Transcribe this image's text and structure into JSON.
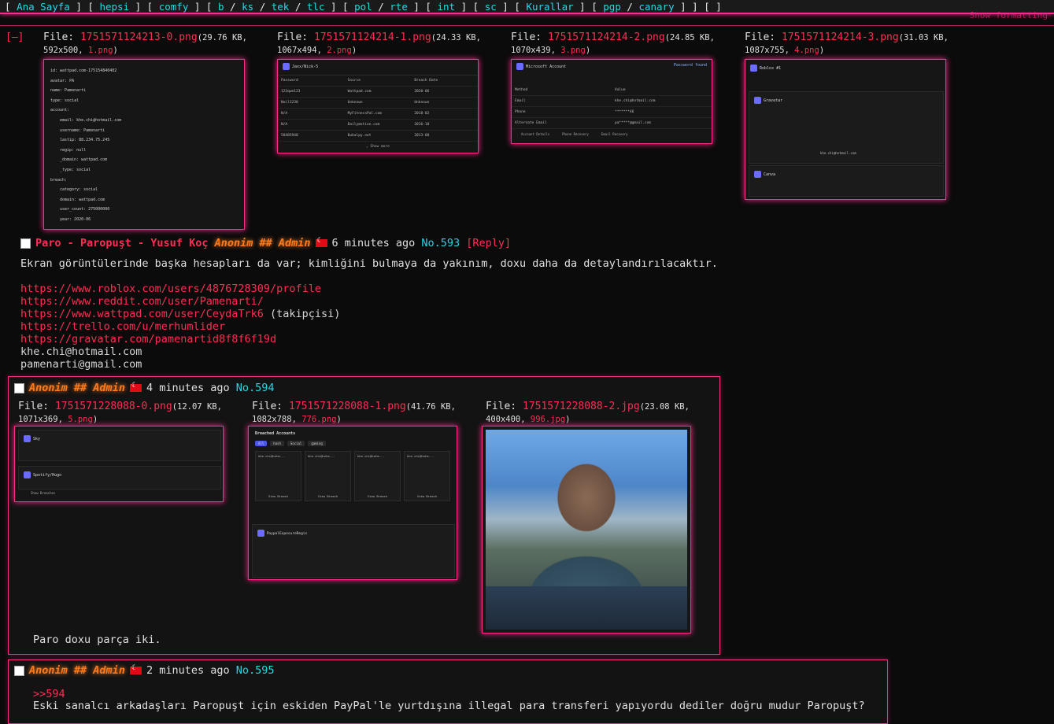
{
  "nav": {
    "items": [
      {
        "label": "Ana Sayfa"
      },
      {
        "label": "hepsi"
      },
      {
        "label": "comfy"
      },
      {
        "label": "b"
      },
      {
        "label": "ks"
      },
      {
        "label": "tek"
      },
      {
        "label": "tlc"
      },
      {
        "label": "pol"
      },
      {
        "label": "rte"
      },
      {
        "label": "int"
      },
      {
        "label": "sc"
      },
      {
        "label": "Kurallar"
      },
      {
        "label": "pgp"
      },
      {
        "label": "canary"
      }
    ],
    "show_formatting": "Show formatting",
    "collapse": "[–]"
  },
  "op": {
    "files": [
      {
        "label": "File:",
        "name": "1751571124213-0.png",
        "size": "(29.76 KB,",
        "dims": "592x500,",
        "orig": "1.png",
        ")": ")"
      },
      {
        "label": "File:",
        "name": "1751571124214-1.png",
        "size": "(24.33 KB,",
        "dims": "1067x494,",
        "orig": "2.png"
      },
      {
        "label": "File:",
        "name": "1751571124214-2.png",
        "size": "(24.85 KB,",
        "dims": "1070x439,",
        "orig": "3.png"
      },
      {
        "label": "File:",
        "name": "1751571124214-3.png",
        "size": "(31.03 KB,",
        "dims": "1087x755,",
        "orig": "4.png"
      }
    ],
    "thumb1": {
      "lines": [
        "id: wattpad.com-175154840402",
        "avatar: PA",
        "name: Pamenarti",
        "type: social",
        "account:",
        "email: khe.chi@hotmail.com",
        "username: Pamenarti",
        "lastip: 88.234.75.245",
        "regip: null",
        "_domain: wattpad.com",
        "_type: social",
        "breach:",
        "category: social",
        "domain: wattpad.com",
        "user_count: 275000000",
        "year: 2020-06"
      ]
    },
    "thumb2": {
      "title": "Jaxx/Nick-5",
      "header": [
        "Password",
        "Source",
        "Breach Date"
      ],
      "rows": [
        [
          "123qwe123",
          "Wattpad.com",
          "2020-06"
        ],
        [
          "Noil1230",
          "Unknown",
          "Unknown"
        ],
        [
          "N/A",
          "MyFitnessPal.com",
          "2018-02"
        ],
        [
          "N/A",
          "Dailymotion.com",
          "2016-10"
        ],
        [
          "58485940",
          "Bukalpy.net",
          "2013-08"
        ]
      ],
      "more": "⌄ Show more"
    },
    "thumb3": {
      "title": "Microsoft Account",
      "badge": "Password found",
      "rows": [
        [
          "Method",
          "Value"
        ],
        [
          "Email",
          "khe.chi@hotmail.com"
        ],
        [
          "Phone",
          "*******46"
        ],
        [
          "Alternate Email",
          "pa*****@gmail.com"
        ]
      ],
      "links": [
        "Account Details",
        "Phone Recovery",
        "Email Recovery"
      ]
    },
    "thumb4": {
      "title": "Roblox #1",
      "sub": "Pamenarti",
      "card2": "Gravatar",
      "email": "khe.chi@hotmail.com",
      "card3": "Canva"
    },
    "subject": "Paro - Paropuşt - Yusuf Koç",
    "name": "Anonim",
    "capcode": "## Admin",
    "time": "6 minutes ago",
    "no_label": "No.",
    "no": "593",
    "reply": "[Reply]",
    "text": "Ekran görüntülerinde başka hesapları da var; kimliğini bulmaya da yakınım, doxu daha da detaylandırılacaktır.",
    "links": [
      "https://www.roblox.com/users/4876728309/profile",
      "https://www.reddit.com/user/Pamenarti/",
      "https://www.wattpad.com/user/CeydaTrk6"
    ],
    "wattpad_note": " (takipçisi)",
    "links2": [
      "https://trello.com/u/merhumlider",
      "https://gravatar.com/pamenartid8f8f6f19d"
    ],
    "emails": [
      "khe.chi@hotmail.com",
      "pamenarti@gmail.com"
    ]
  },
  "reply594": {
    "name": "Anonim",
    "capcode": "## Admin",
    "time": "4 minutes ago",
    "no_label": "No.",
    "no": "594",
    "files": [
      {
        "label": "File:",
        "name": "1751571228088-0.png",
        "size": "(12.07 KB,",
        "dims": "1071x369,",
        "orig": "5.png"
      },
      {
        "label": "File:",
        "name": "1751571228088-1.png",
        "size": "(41.76 KB,",
        "dims": "1082x788,",
        "orig": "776.png"
      },
      {
        "label": "File:",
        "name": "1751571228088-2.jpg",
        "size": "(23.08 KB,",
        "dims": "400x400,",
        "orig": "996.jpg"
      }
    ],
    "t5": {
      "a": "Sky",
      "b": "Spotify/Hugo",
      "btn": "Show Breaches"
    },
    "t6": {
      "title": "Breached Accounts",
      "tabs": [
        "All",
        "hash",
        "Social",
        "gaming"
      ],
      "cards": [
        "khe.chi@hotm...",
        "khe.chi@hotm...",
        "khe.chi@hotm...",
        "khe.chi@hotm..."
      ],
      "view": "View Breach",
      "footer": "PaypalExposureRegis"
    },
    "text": "Paro doxu parça iki."
  },
  "reply595": {
    "name": "Anonim",
    "capcode": "## Admin",
    "time": "2 minutes ago",
    "no_label": "No.",
    "no": "595",
    "quote": ">>594",
    "text": "Eski sanalcı arkadaşları Paropuşt için eskiden PayPal'le yurtdışına illegal para transferi yapıyordu dediler doğru mudur Paropuşt?"
  }
}
